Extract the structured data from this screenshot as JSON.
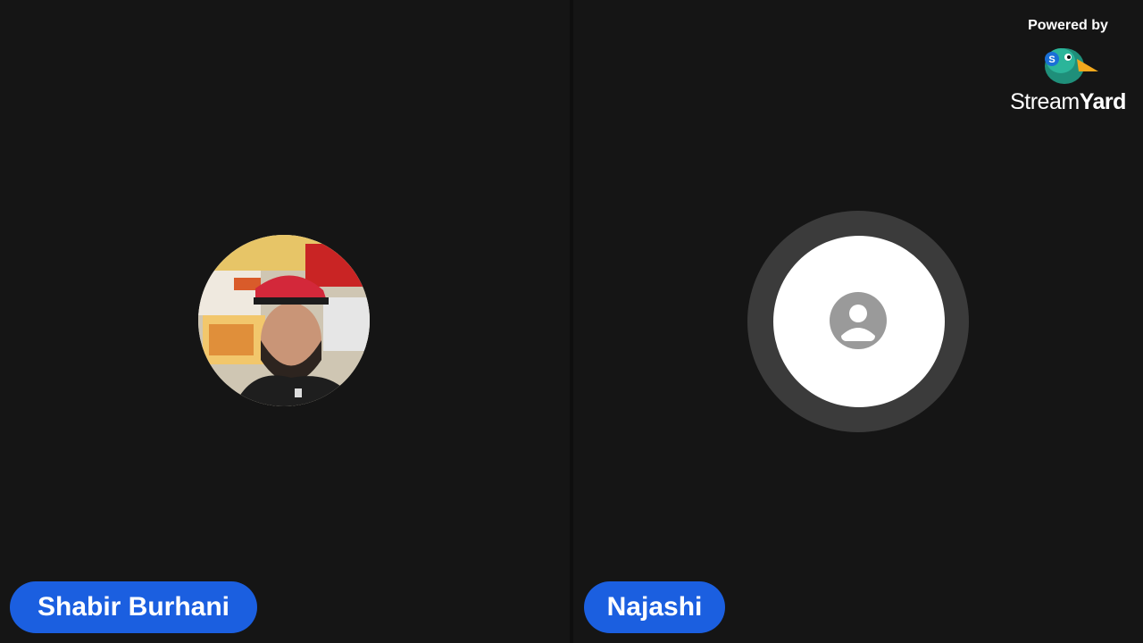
{
  "participants": [
    {
      "name": "Shabir Burhani",
      "avatar": "photo-avatar"
    },
    {
      "name": "Najashi",
      "avatar": "default-user-icon"
    }
  ],
  "branding": {
    "powered_by": "Powered by",
    "wordmark_part1": "Stream",
    "wordmark_part2": "Yard",
    "logo_icon": "streamyard-duck-icon"
  },
  "colors": {
    "background": "#141414",
    "name_tag": "#1b5fe0",
    "avatar_ring": "#3b3b3b",
    "avatar_plate": "#ffffff",
    "user_icon": "#9a9a9a"
  }
}
